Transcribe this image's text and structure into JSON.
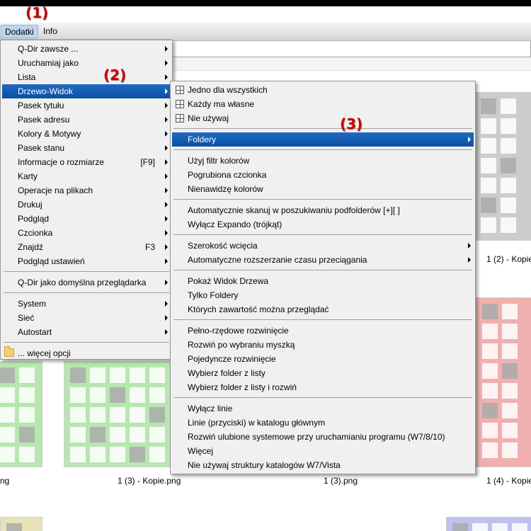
{
  "menubar": {
    "items": [
      {
        "label": "Dodatki",
        "active": true
      },
      {
        "label": "Info",
        "active": false
      }
    ]
  },
  "markers": [
    "(1)",
    "(2)",
    "(3)"
  ],
  "thumbnails": [
    {
      "label": "1 (2) - Kopie",
      "color": "#cccccc",
      "fill": "#aaaaaa"
    },
    {
      "label": "ng",
      "color": "#b8e6b0",
      "fill": "#aaaaaa"
    },
    {
      "label": "1 (3) - Kopie.png",
      "color": "#b8e6b0",
      "fill": "#aaaaaa"
    },
    {
      "label": "1 (3).png",
      "color": "#cccccc",
      "fill": "#aaaaaa"
    },
    {
      "label": "1 (4) - Kopie",
      "color": "#f0b0b0",
      "fill": "#aaaaaa"
    },
    {
      "label": "",
      "color": "#e8e2b8",
      "fill": "#aaaaaa"
    },
    {
      "label": "",
      "color": "#c0c0f0",
      "fill": "#aaaaaa"
    }
  ],
  "main_menu": {
    "items": [
      {
        "label": "Q-Dir zawsze ...",
        "shortcut": "",
        "submenu": true
      },
      {
        "label": "Uruchamiaj jako",
        "shortcut": "",
        "submenu": true
      },
      {
        "label": "Lista",
        "shortcut": "",
        "submenu": true
      },
      {
        "label": "Drzewo-Widok",
        "shortcut": "",
        "submenu": true,
        "selected": true
      },
      {
        "label": "Pasek tytułu",
        "shortcut": "",
        "submenu": true
      },
      {
        "label": "Pasek adresu",
        "shortcut": "",
        "submenu": true
      },
      {
        "label": "Kolory & Motywy",
        "shortcut": "",
        "submenu": true
      },
      {
        "label": "Pasek stanu",
        "shortcut": "",
        "submenu": true
      },
      {
        "label": "Informacje o rozmiarze",
        "shortcut": "[F9]",
        "submenu": true
      },
      {
        "label": "Karty",
        "shortcut": "",
        "submenu": true
      },
      {
        "label": "Operacje na plikach",
        "shortcut": "",
        "submenu": true
      },
      {
        "label": "Drukuj",
        "shortcut": "",
        "submenu": true
      },
      {
        "label": "Podgląd",
        "shortcut": "",
        "submenu": true
      },
      {
        "label": "Czcionka",
        "shortcut": "",
        "submenu": true
      },
      {
        "label": "Znajdź",
        "shortcut": "F3",
        "submenu": true
      },
      {
        "label": "Podgląd ustawień",
        "shortcut": "",
        "submenu": true
      },
      {
        "sep": true
      },
      {
        "label": "Q-Dir jako domyślna przeglądarka",
        "shortcut": "",
        "submenu": true
      },
      {
        "sep": true
      },
      {
        "label": "System",
        "shortcut": "",
        "submenu": true
      },
      {
        "label": "Sieć",
        "shortcut": "",
        "submenu": true
      },
      {
        "label": "Autostart",
        "shortcut": "",
        "submenu": true
      },
      {
        "sep": true
      },
      {
        "label": "... więcej opcji",
        "shortcut": "",
        "submenu": false,
        "icon": "folder-icon"
      }
    ]
  },
  "sub_menu": {
    "items": [
      {
        "label": "Jedno dla wszystkich",
        "icon": "grid-icon"
      },
      {
        "label": "Każdy ma własne",
        "icon": "grid-icon"
      },
      {
        "label": "Nie używaj",
        "icon": "grid-icon"
      },
      {
        "sep": true
      },
      {
        "label": "Foldery",
        "submenu": true,
        "selected": true
      },
      {
        "sep": true
      },
      {
        "label": "Użyj filtr kolorów"
      },
      {
        "label": "Pogrubiona czcionka"
      },
      {
        "label": "Nienawidzę kolorów"
      },
      {
        "sep": true
      },
      {
        "label": "Automatycznie skanuj w poszukiwaniu podfolderów [+][ ]"
      },
      {
        "label": "Wyłącz Expando (trójkąt)"
      },
      {
        "sep": true
      },
      {
        "label": "Szerokość wcięcia",
        "submenu": true
      },
      {
        "label": "Automatyczne rozszerzanie czasu przeciągania",
        "submenu": true
      },
      {
        "sep": true
      },
      {
        "label": "Pokaż Widok Drzewa"
      },
      {
        "label": "Tylko Foldery"
      },
      {
        "label": "Których zawartość można przeglądać"
      },
      {
        "sep": true
      },
      {
        "label": "Pełno-rzędowe rozwinięcie"
      },
      {
        "label": "Rozwiń po wybraniu myszką"
      },
      {
        "label": "Pojedyncze rozwinięcie"
      },
      {
        "label": "Wybierz folder z listy"
      },
      {
        "label": "Wybierz folder z listy i rozwiń"
      },
      {
        "sep": true
      },
      {
        "label": "Wyłącz linie"
      },
      {
        "label": "Linie (przyciski) w katalogu głównym"
      },
      {
        "label": "Rozwiń ulubione systemowe przy uruchamianiu programu (W7/8/10)"
      },
      {
        "label": "Więcej"
      },
      {
        "label": "Nie używaj struktury katalogów W7/Vista"
      }
    ]
  }
}
